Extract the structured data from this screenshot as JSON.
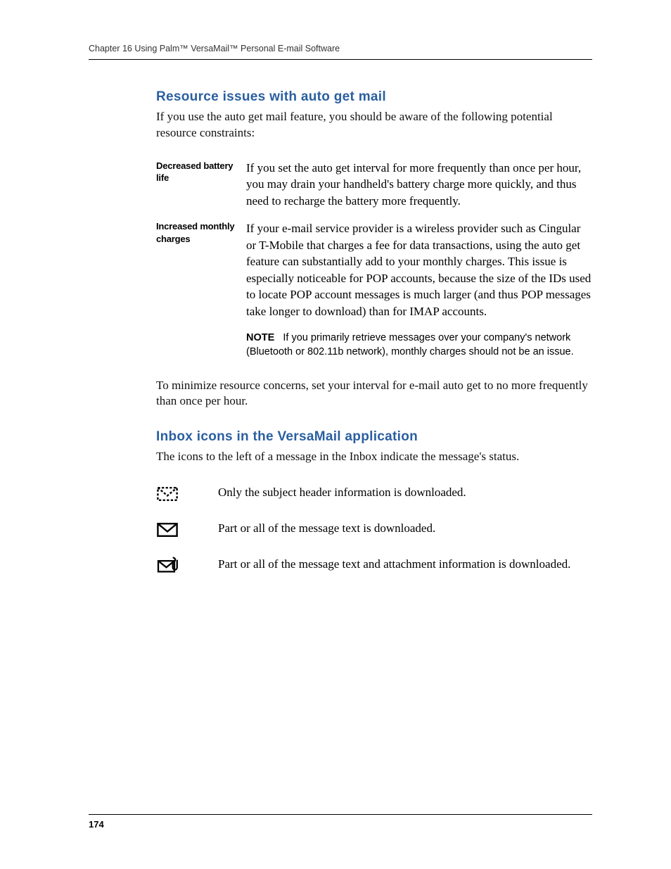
{
  "header": "Chapter 16   Using Palm™ VersaMail™ Personal E-mail Software",
  "section1": {
    "heading": "Resource issues with auto get mail",
    "intro": "If you use the auto get mail feature, you should be aware of the following potential resource constraints:",
    "rows": [
      {
        "label": "Decreased battery life",
        "text": "If you set the auto get interval for more frequently than once per hour, you may drain your handheld's battery charge more quickly, and thus need to recharge the battery more frequently."
      },
      {
        "label": "Increased monthly charges",
        "text": "If your e-mail service provider is a wireless provider such as Cingular or T-Mobile that charges a fee for data transactions, using the auto get feature can substantially add to your monthly charges. This issue is especially noticeable for POP accounts, because the size of the IDs used to locate POP account messages is much larger (and thus POP messages take longer to download) than for IMAP accounts.",
        "note_label": "NOTE",
        "note_text": "If you primarily retrieve messages over your company's network (Bluetooth or 802.11b network), monthly charges should not be an issue."
      }
    ],
    "outro": "To minimize resource concerns, set your interval for e-mail auto get to no more frequently than once per hour."
  },
  "section2": {
    "heading": "Inbox icons in the VersaMail application",
    "intro": "The icons to the left of a message in the Inbox indicate the message's status.",
    "icons": [
      {
        "desc": "Only the subject header information is downloaded."
      },
      {
        "desc": "Part or all of the message text is downloaded."
      },
      {
        "desc": "Part or all of the message text and attachment information is downloaded."
      }
    ]
  },
  "page_number": "174"
}
